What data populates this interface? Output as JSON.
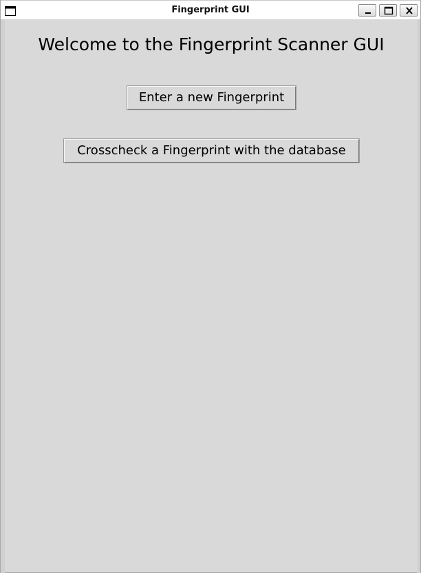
{
  "window": {
    "title": "Fingerprint GUI",
    "controls": {
      "minimize": "minimize",
      "maximize": "maximize",
      "close": "close"
    }
  },
  "main": {
    "heading": "Welcome to the Fingerprint Scanner GUI",
    "buttons": {
      "enter_new": "Enter a new Fingerprint",
      "crosscheck": "Crosscheck a Fingerprint with the database"
    }
  },
  "colors": {
    "background": "#d9d9d9",
    "titlebar": "#ffffff",
    "text": "#000000"
  }
}
